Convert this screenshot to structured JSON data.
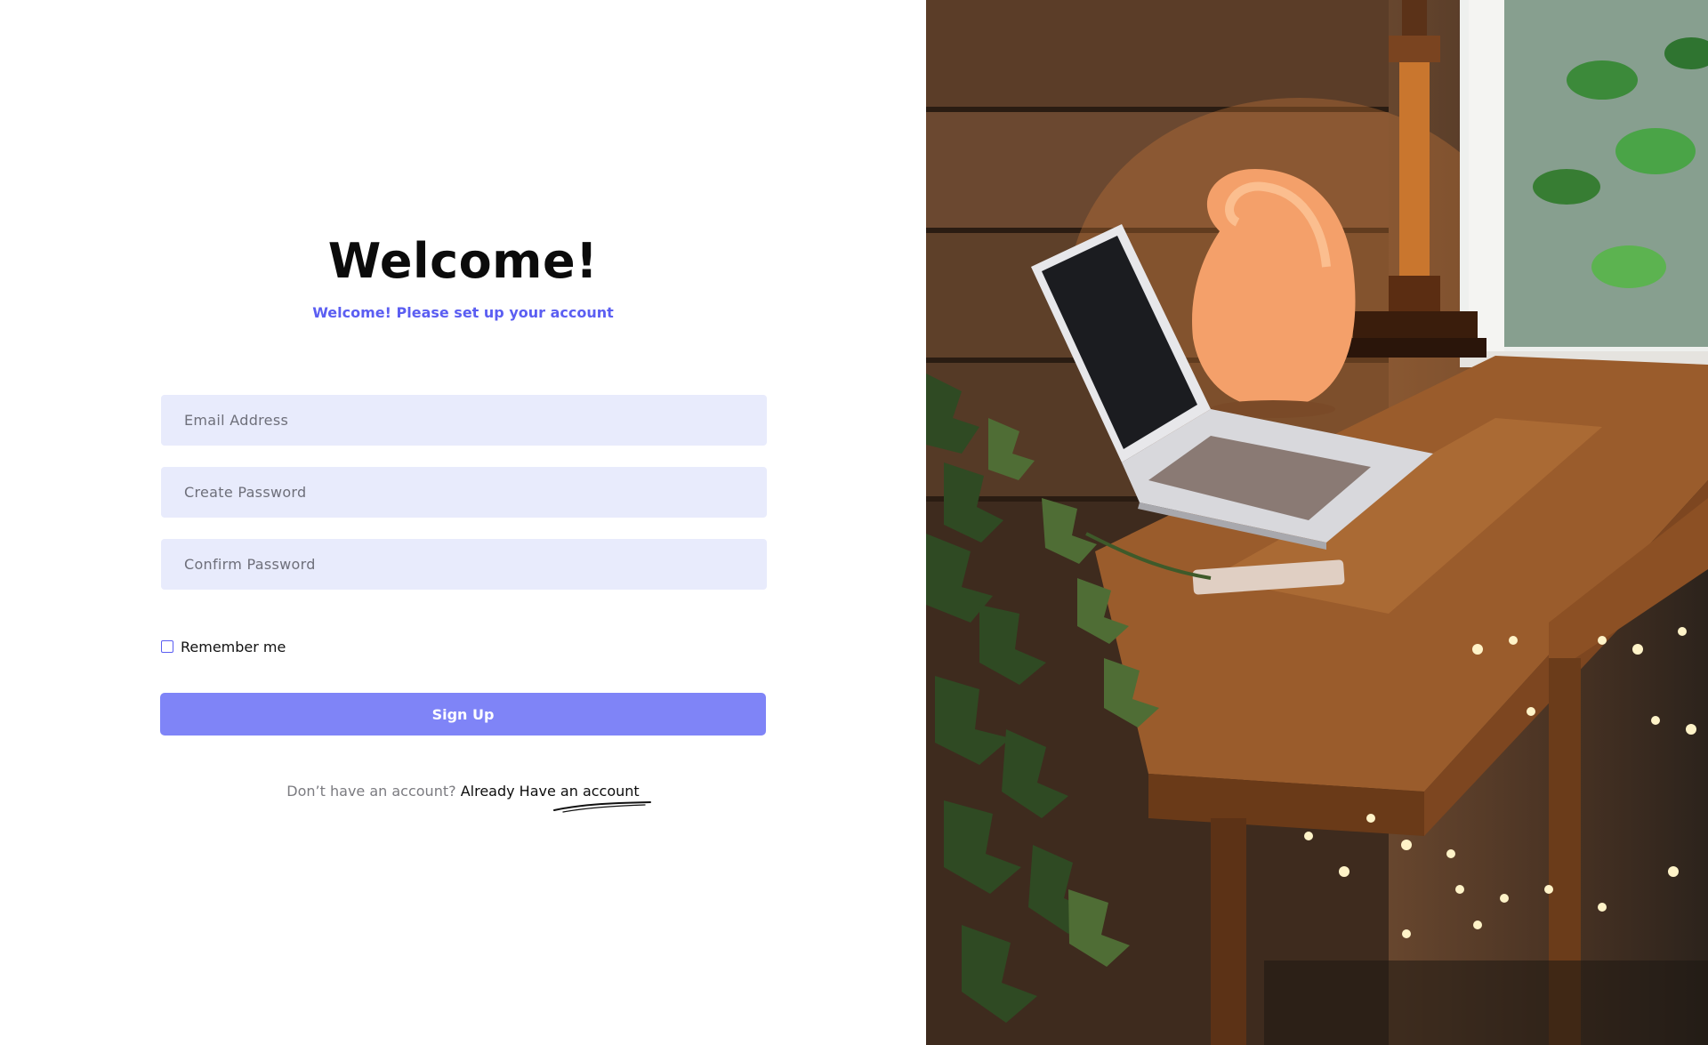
{
  "header": {
    "title": "Welcome!",
    "subtitle": "Welcome! Please set up your account"
  },
  "form": {
    "email_placeholder": "Email Address",
    "create_password_placeholder": "Create Password",
    "confirm_password_placeholder": "Confirm Password",
    "remember_label": "Remember me",
    "submit_label": "Sign Up"
  },
  "footer": {
    "prompt_text": "Don’t have an account?",
    "link_text": "Already Have an account"
  },
  "colors": {
    "accent": "#5b5ef2",
    "button": "#7f84f7",
    "field_bg": "#e8ebfc"
  },
  "hero_image": {
    "subject": "laptop on wooden desk with salt lamp and ivy plant"
  }
}
